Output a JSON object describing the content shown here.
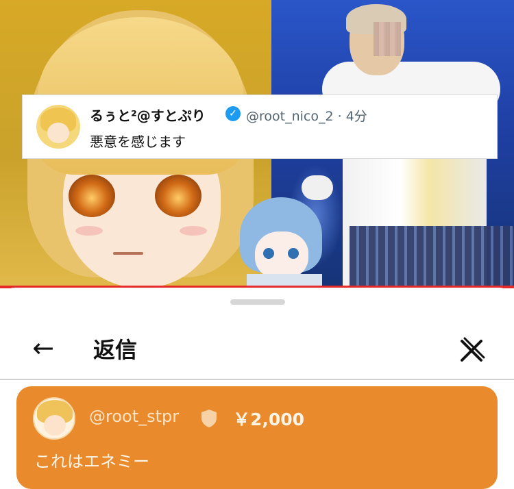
{
  "tweet": {
    "display_name": "るぅと²@すとぷり",
    "handle_time": "@root_nico_2 · 4分",
    "text": "悪意を感じます"
  },
  "header": {
    "title": "返信",
    "back_icon": "arrow-left-icon",
    "close_icon": "close-icon"
  },
  "super_chat": {
    "username": "@root_stpr",
    "amount": "￥2,000",
    "message": "これはエネミー",
    "color": "#e98a2d",
    "badge_icon": "shield-icon"
  }
}
